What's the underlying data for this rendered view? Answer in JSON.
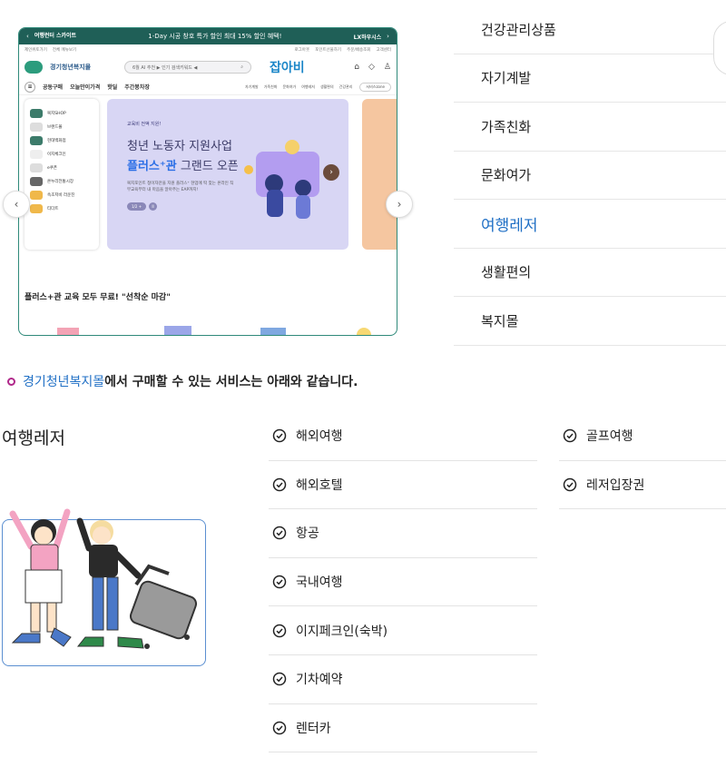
{
  "mock": {
    "banner_brand": "여행런터 스카이트",
    "banner_text": "1-Day 시공 창호 특가 할인  최대 15% 할인 혜택!",
    "banner_partner": "LX하우시스",
    "top_left": [
      "제인위토가기",
      "전체 메뉴보기"
    ],
    "top_right": [
      "로그아웃",
      "포인트선물하기",
      "주문/배송조회",
      "고객센터"
    ],
    "logo_text": "경기청년복지몰",
    "search_placeholder": "6월 AI 추천 ▶ 인기 검색키워드 ◀",
    "jobabi": "잡아비",
    "nav": [
      "공동구매",
      "오늘만이가격",
      "핫딜",
      "주간봉차장"
    ],
    "nav_sub": [
      "자기계발",
      "가족친화",
      "문화여가",
      "여행레저",
      "생활편의",
      "건강관리"
    ],
    "nav_select": "서비스zone",
    "sidebar": [
      "복지SHOP",
      "브랜드몰",
      "현대백화점",
      "이지체크인",
      "e쿠폰",
      "온누리전통시장",
      "속초저비 라운진",
      "티다트"
    ],
    "hero_tag": "교육비 전액 지원!",
    "hero_title1": "청년 노동자 지원사업",
    "hero_title2_blue": "플러스⁺관",
    "hero_title2_rest": " 그랜드 오픈",
    "hero_desc": "복지포인트 청이자만을 지원 플러스⁺ 현업에 딱 맞는 온라인 직무교육부터 내 마음을 알아주는 EAP까지!",
    "hero_pager": "1/2 +",
    "hero_pager_pause": "II",
    "caption": "플러스+관 교육 모두 무료! \"선착순 마감\""
  },
  "categories": [
    "건강관리상품",
    "자기계발",
    "가족친화",
    "문화여가",
    "여행레저",
    "생활편의",
    "복지몰"
  ],
  "active_category": "여행레저",
  "intro": {
    "highlight": "경기청년복지몰",
    "rest": "에서 구매할 수 있는 서비스는 아래와 같습니다."
  },
  "section_title": "여행레저",
  "services_col1": [
    "해외여행",
    "해외호텔",
    "항공",
    "국내여행",
    "이지페크인(숙박)",
    "기차예약",
    "렌터카"
  ],
  "services_col2": [
    "골프여행",
    "레저입장권"
  ],
  "colors": {
    "accent": "#1f6fc5",
    "ring": "#b0288a",
    "banner": "#1f5f57"
  }
}
